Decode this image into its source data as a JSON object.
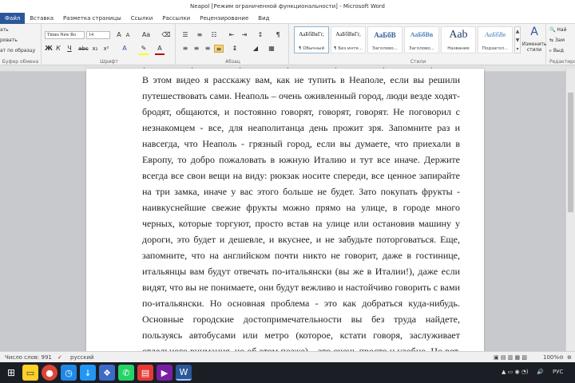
{
  "window": {
    "title": "Neapol [Режим ограниченной функциональности] - Microsoft Word"
  },
  "tabs": [
    {
      "label": "Файл"
    },
    {
      "label": "Вставка"
    },
    {
      "label": "Разметка страницы"
    },
    {
      "label": "Ссылки"
    },
    {
      "label": "Рассылки"
    },
    {
      "label": "Рецензирование"
    },
    {
      "label": "Вид"
    }
  ],
  "ribbon": {
    "clipboard": {
      "items": [
        "ать",
        "ровать",
        "ат по образцу"
      ],
      "label": "Буфер обмена"
    },
    "font": {
      "font_name": "Times New Ro",
      "font_size": "14",
      "label": "Шрифт",
      "text_color": "#c00000",
      "highlight_color": "#ffff00"
    },
    "paragraph": {
      "label": "Абзац"
    },
    "styles": {
      "label": "Стили",
      "items": [
        {
          "sample": "АаБбВвГг,",
          "name": "¶ Обычный"
        },
        {
          "sample": "АаБбВвГг,",
          "name": "¶ Без инте..."
        },
        {
          "sample": "АаБбВ",
          "name": "Заголово..."
        },
        {
          "sample": "АаБбВв",
          "name": "Заголово..."
        },
        {
          "sample": "Ааb",
          "name": "Название"
        },
        {
          "sample": "АаБбВв",
          "name": "Подзагол..."
        }
      ],
      "change_styles": "Изменить стили"
    },
    "editing": {
      "items": [
        "Най",
        "Зам",
        "Выд"
      ],
      "label": "Редактирован"
    }
  },
  "document": {
    "text": "В этом видео я расскажу вам, как не тупить в Неаполе, если вы решили путешествовать сами. Неаполь – очень оживленный город, люди везде ходят-бродят, общаются, и постоянно говорят, говорят, говорят. Не поговорил с незнакомцем - все, для неаполитанца день прожит зря. Запомните раз и навсегда, что Неаполь - грязный город, если вы думаете, что приехали в Европу, то добро пожаловать в южную Италию и тут все иначе. Держите всегда все свои вещи на виду: рюкзак носите спереди, все ценное запирайте на три замка, иначе у вас этого больше не будет. Зато покупать фрукты - наивкуснейшие свежие фрукты можно прямо на улице, в городе много черных, которые торгуют, просто встав на улице или остановив машину у дороги, это будет и дешевле, и вкуснее, и не забудьте поторговаться. Еще, запомните, что на английском почти никто не говорит, даже в гостинице, итальянцы вам будут отвечать по-итальянски (вы же в Италии!), даже если видят, что вы не понимаете, они будут вежливо и настойчиво говорить с вами по-итальянски. Но основная проблема - это как добраться куда-нибудь. Основные городские достопримечательности вы без труда найдете, пользуясь автобусами или метро (которое, кстати говоря, заслуживает отдельного внимания, но об этом позже) – это очень просто и удобно. Но вот, например,"
  },
  "statusbar": {
    "word_count": "Число слов: 991",
    "language": "русский",
    "zoom": "100%"
  },
  "taskbar": {
    "tray_language": "РУС"
  }
}
